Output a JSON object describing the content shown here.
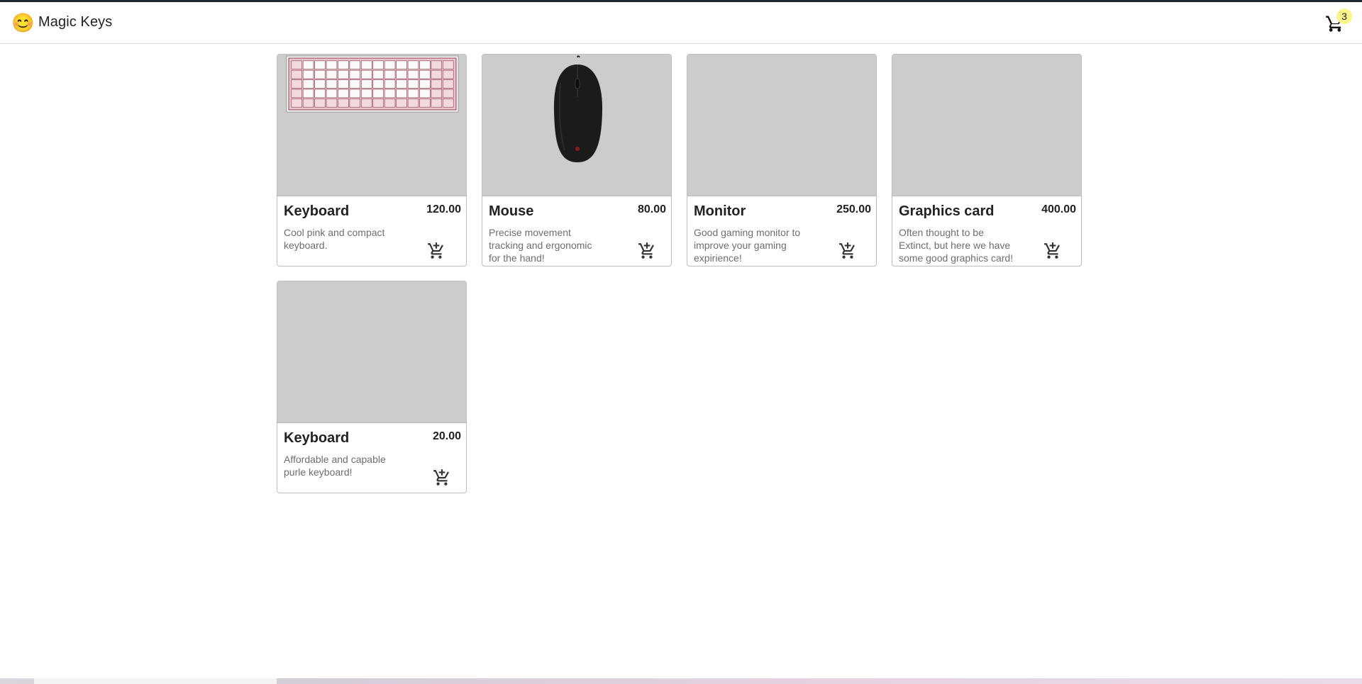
{
  "header": {
    "logo_icon": "smiley-face-icon",
    "title": "Magic Keys",
    "cart_icon": "shopping-cart-icon",
    "cart_count": "3"
  },
  "products": [
    {
      "name": "Keyboard",
      "price": "120.00",
      "description": "Cool pink and compact keyboard.",
      "image": "pink-compact-keyboard-image",
      "add_icon": "add-to-cart-icon"
    },
    {
      "name": "Mouse",
      "price": "80.00",
      "description": "Precise movement tracking and ergonomic for the hand!",
      "image": "black-gaming-mouse-image",
      "add_icon": "add-to-cart-icon"
    },
    {
      "name": "Monitor",
      "price": "250.00",
      "description": "Good gaming monitor to improve your gaming expirience!",
      "image": "placeholder-image",
      "add_icon": "add-to-cart-icon"
    },
    {
      "name": "Graphics card",
      "price": "400.00",
      "description": "Often thought to be Extinct, but here we have some good graphics card!",
      "image": "placeholder-image",
      "add_icon": "add-to-cart-icon"
    },
    {
      "name": "Keyboard",
      "price": "20.00",
      "description": "Affordable and capable purle keyboard!",
      "image": "placeholder-image",
      "add_icon": "add-to-cart-icon"
    }
  ],
  "colors": {
    "placeholder_bg": "#cccccc",
    "badge_bg": "#fdf58a",
    "text_dark": "#222222",
    "text_muted": "#6e6e6e"
  }
}
